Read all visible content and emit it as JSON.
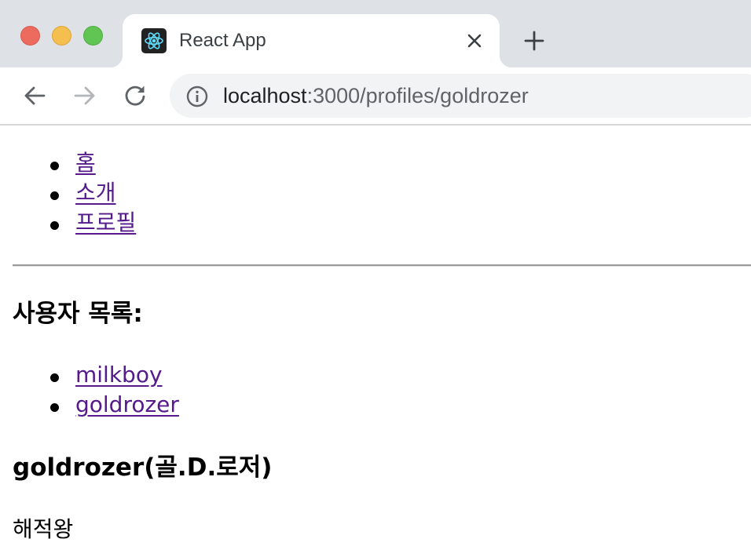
{
  "browser": {
    "tab": {
      "title": "React App",
      "favicon": "react-logo-icon"
    },
    "address_bar": {
      "host": "localhost",
      "path": ":3000/profiles/goldrozer"
    },
    "colors": {
      "tabstrip": "#dee1e6",
      "omnibox": "#f1f3f4"
    }
  },
  "nav": {
    "items": [
      {
        "label": "홈"
      },
      {
        "label": "소개"
      },
      {
        "label": "프로필"
      }
    ]
  },
  "users_section": {
    "heading": "사용자 목록:",
    "users": [
      {
        "label": "milkboy"
      },
      {
        "label": "goldrozer"
      }
    ]
  },
  "profile": {
    "heading": "goldrozer(골.D.로저)",
    "description": "해적왕"
  },
  "colors": {
    "link": "#551a8b"
  }
}
